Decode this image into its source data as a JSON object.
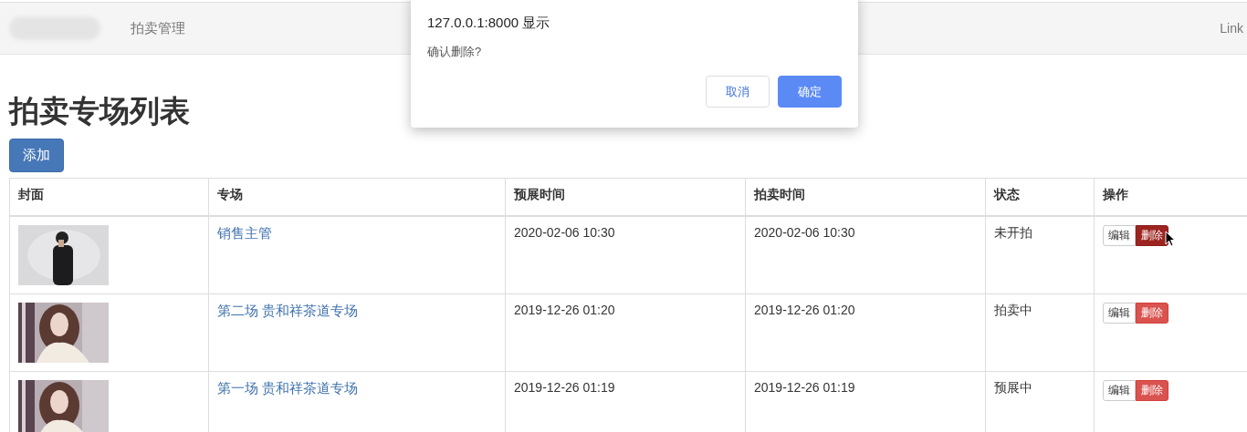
{
  "navbar": {
    "brand": {
      "kind": "blurred"
    },
    "items": [
      "拍卖管理"
    ],
    "right_link": "Link"
  },
  "heading": "拍卖专场列表",
  "add_button": "添加",
  "table": {
    "columns": [
      "封面",
      "专场",
      "预展时间",
      "拍卖时间",
      "状态",
      "操作"
    ],
    "rows": [
      {
        "session": "销售主管",
        "preview_time": "2020-02-06 10:30",
        "auction_time": "2020-02-06 10:30",
        "status": "未开拍",
        "edit": "编辑",
        "delete": "删除",
        "delete_hovered": true
      },
      {
        "session": "第二场 贵和祥茶道专场",
        "preview_time": "2019-12-26 01:20",
        "auction_time": "2019-12-26 01:20",
        "status": "拍卖中",
        "edit": "编辑",
        "delete": "删除",
        "delete_hovered": false
      },
      {
        "session": "第一场 贵和祥茶道专场",
        "preview_time": "2019-12-26 01:19",
        "auction_time": "2019-12-26 01:19",
        "status": "预展中",
        "edit": "编辑",
        "delete": "删除",
        "delete_hovered": false
      }
    ]
  },
  "dialog": {
    "title": "127.0.0.1:8000 显示",
    "message": "确认删除?",
    "cancel": "取消",
    "ok": "确定"
  }
}
